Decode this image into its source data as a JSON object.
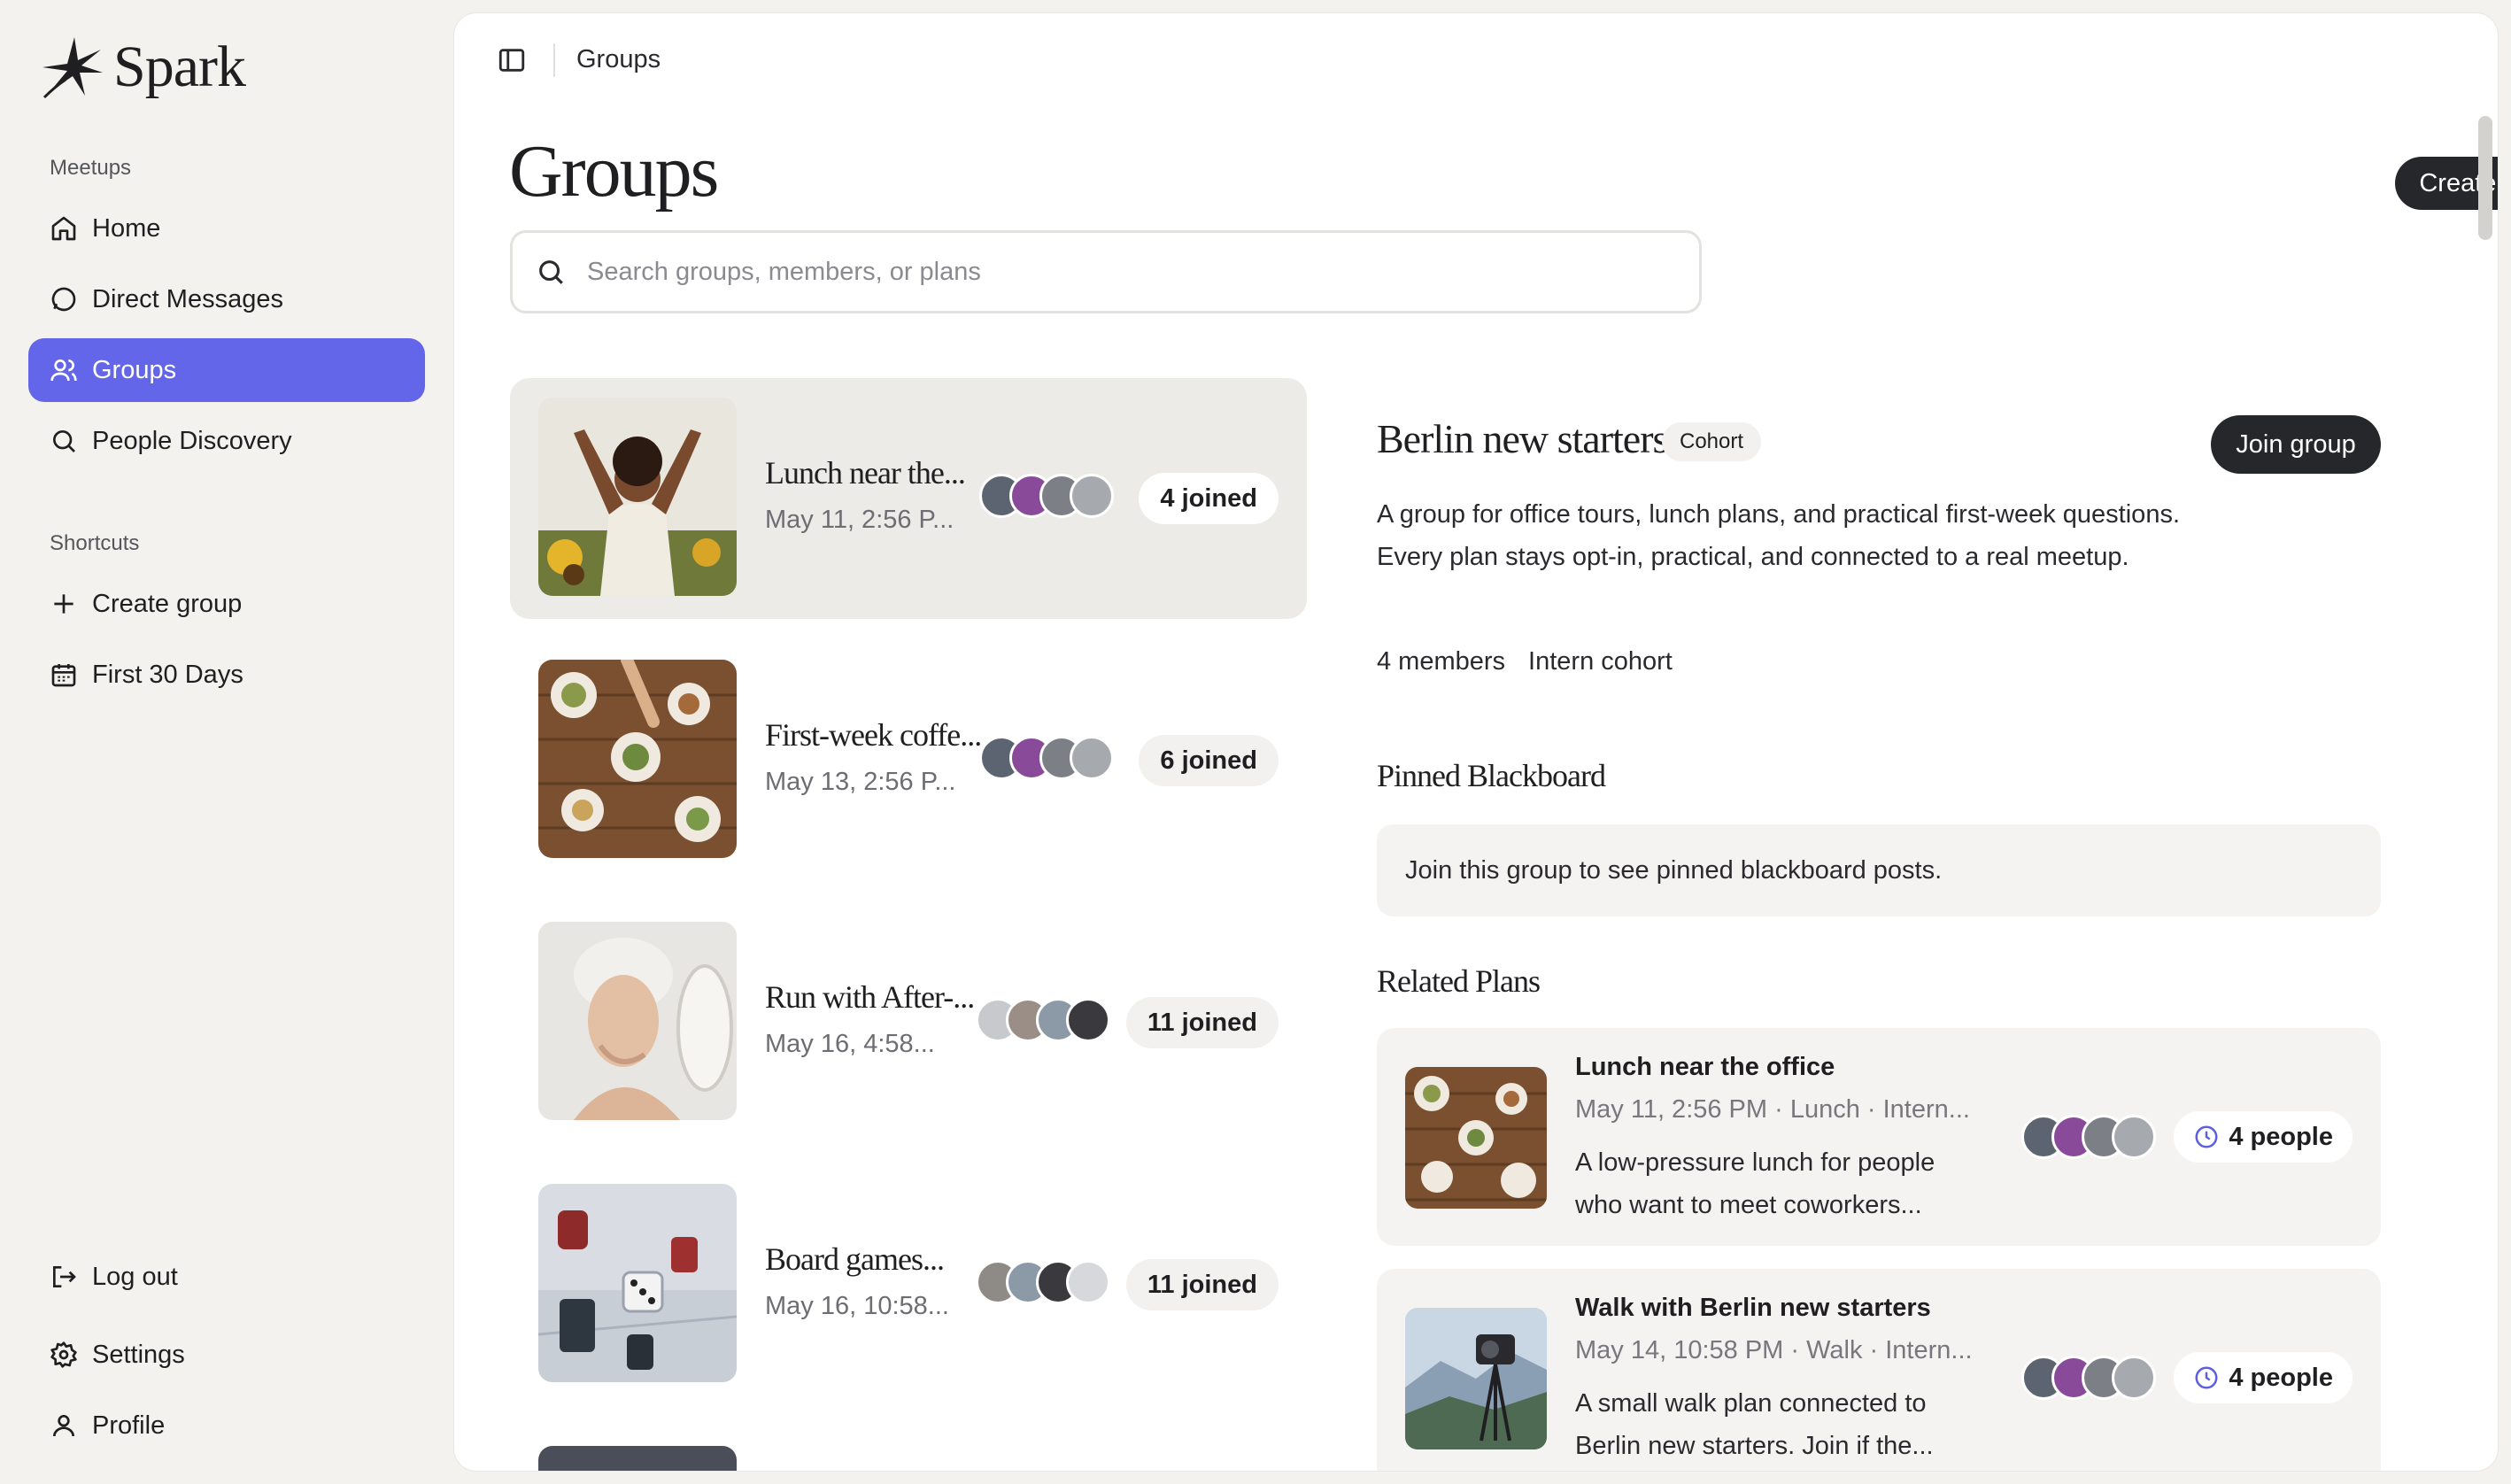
{
  "app": {
    "name": "Spark"
  },
  "sidebar": {
    "section_meetups": "Meetups",
    "section_shortcuts": "Shortcuts",
    "items": [
      {
        "label": "Home"
      },
      {
        "label": "Direct Messages"
      },
      {
        "label": "Groups"
      },
      {
        "label": "People Discovery"
      }
    ],
    "shortcuts": [
      {
        "label": "Create group"
      },
      {
        "label": "First 30 Days"
      }
    ],
    "bottom": [
      {
        "label": "Log out"
      },
      {
        "label": "Settings"
      },
      {
        "label": "Profile"
      }
    ],
    "active_color": "#6366e9"
  },
  "header": {
    "breadcrumb": "Groups"
  },
  "page": {
    "title": "Groups",
    "create_button": "Create group",
    "search_placeholder": "Search groups, members, or plans"
  },
  "groups": [
    {
      "name": "Lunch near the...",
      "date": "May 11, 2:56 P...",
      "joined": "4 joined"
    },
    {
      "name": "First-week coffe...",
      "date": "May 13, 2:56 P...",
      "joined": "6 joined"
    },
    {
      "name": "Run with After-...",
      "date": "May 16, 4:58...",
      "joined": "11 joined"
    },
    {
      "name": "Board games...",
      "date": "May 16, 10:58...",
      "joined": "11 joined"
    }
  ],
  "detail": {
    "title": "Berlin new starters",
    "badge": "Cohort",
    "join_button": "Join group",
    "description": "A group for office tours, lunch plans, and practical first-week questions. Every plan stays opt-in, practical, and connected to a real meetup.",
    "members": "4 members",
    "type": "Intern cohort",
    "pinned_title": "Pinned Blackboard",
    "pinned_notice": "Join this group to see pinned blackboard posts.",
    "related_title": "Related Plans",
    "plans": [
      {
        "title": "Lunch near the office",
        "subtitle": "May 11, 2:56 PM · Lunch · Intern...",
        "description": "A low-pressure lunch for people who want to meet coworkers...",
        "people": "4 people"
      },
      {
        "title": "Walk with Berlin new starters",
        "subtitle": "May 14, 10:58 PM · Walk · Intern...",
        "description": "A small walk plan connected to Berlin new starters. Join if the...",
        "people": "4 people"
      }
    ]
  }
}
